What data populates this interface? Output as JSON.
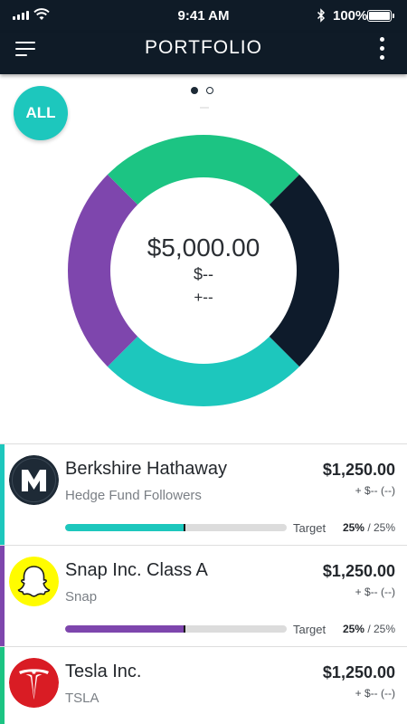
{
  "status_bar": {
    "time": "9:41 AM",
    "battery": "100%"
  },
  "nav": {
    "title": "PORTFOLIO"
  },
  "filter": {
    "all_label": "ALL"
  },
  "summary": {
    "total": "$5,000.00",
    "change_value": "$--",
    "change_percent": "+--"
  },
  "allocation": [
    {
      "color": "#1dc7bd",
      "share": 0.25
    },
    {
      "color": "#7e46ad",
      "share": 0.25
    },
    {
      "color": "#1cc483",
      "share": 0.25
    },
    {
      "color": "#0e1b2b",
      "share": 0.25
    }
  ],
  "holdings": [
    {
      "name": "Berkshire Hathaway",
      "subtitle": "Hedge Fund Followers",
      "value": "$1,250.00",
      "change": "+ $-- (--)",
      "target_label": "Target",
      "current_pct": "25%",
      "target_pct": "/ 25%",
      "progress": 0.54,
      "accent": "#1dc7bd",
      "logo": "m-letter-icon"
    },
    {
      "name": "Snap Inc. Class A",
      "subtitle": "Snap",
      "value": "$1,250.00",
      "change": "+ $-- (--)",
      "target_label": "Target",
      "current_pct": "25%",
      "target_pct": "/ 25%",
      "progress": 0.54,
      "accent": "#7e46ad",
      "logo": "snapchat-ghost-icon"
    },
    {
      "name": "Tesla Inc.",
      "subtitle": "TSLA",
      "value": "$1,250.00",
      "change": "+ $-- (--)",
      "accent": "#1cc483",
      "logo": "tesla-logo-icon"
    }
  ]
}
